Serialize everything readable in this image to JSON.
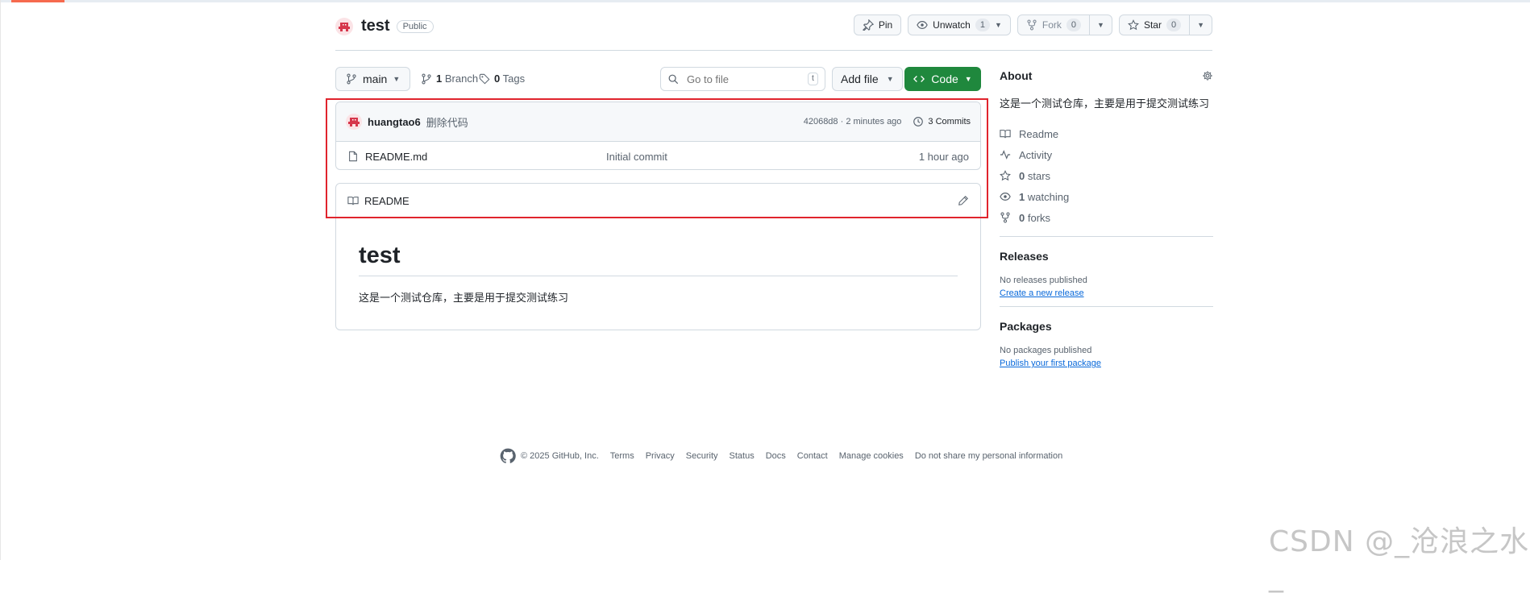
{
  "repo": {
    "name": "test",
    "visibility": "Public"
  },
  "actions": {
    "pin": "Pin",
    "unwatch": "Unwatch",
    "watch_count": "1",
    "fork": "Fork",
    "fork_count": "0",
    "star": "Star",
    "star_count": "0"
  },
  "toolbar": {
    "branch": "main",
    "branches_count": "1",
    "branches_label": "Branch",
    "tags_count": "0",
    "tags_label": "Tags",
    "search_placeholder": "Go to file",
    "search_key": "t",
    "add_file": "Add file",
    "code": "Code"
  },
  "latest_commit": {
    "author": "huangtao6",
    "message": "删除代码",
    "hash_time": "42068d8 · 2 minutes ago",
    "commits_count": "3",
    "commits_label": "Commits"
  },
  "files": [
    {
      "name": "README.md",
      "message": "Initial commit",
      "time": "1 hour ago"
    }
  ],
  "readme": {
    "tab": "README",
    "heading": "test",
    "body": "这是一个测试仓库，主要是用于提交测试练习"
  },
  "about": {
    "title": "About",
    "description": "这是一个测试仓库，主要是用于提交测试练习",
    "items": [
      {
        "icon": "book-icon",
        "label": "Readme"
      },
      {
        "icon": "pulse-icon",
        "label": "Activity"
      },
      {
        "icon": "star-icon",
        "count": "0",
        "label": "stars"
      },
      {
        "icon": "eye-icon",
        "count": "1",
        "label": "watching"
      },
      {
        "icon": "fork-icon",
        "count": "0",
        "label": "forks"
      }
    ]
  },
  "releases": {
    "title": "Releases",
    "empty": "No releases published",
    "link": "Create a new release"
  },
  "packages": {
    "title": "Packages",
    "empty": "No packages published",
    "link": "Publish your first package"
  },
  "footer": {
    "copyright": "© 2025 GitHub, Inc.",
    "links": [
      "Terms",
      "Privacy",
      "Security",
      "Status",
      "Docs",
      "Contact",
      "Manage cookies",
      "Do not share my personal information"
    ]
  },
  "watermark": "CSDN @_沧浪之水_",
  "colors": {
    "accent_green": "#1f883d",
    "link_blue": "#0969da",
    "highlight_red": "#e0242d",
    "tab_underline": "#fd8c73"
  }
}
